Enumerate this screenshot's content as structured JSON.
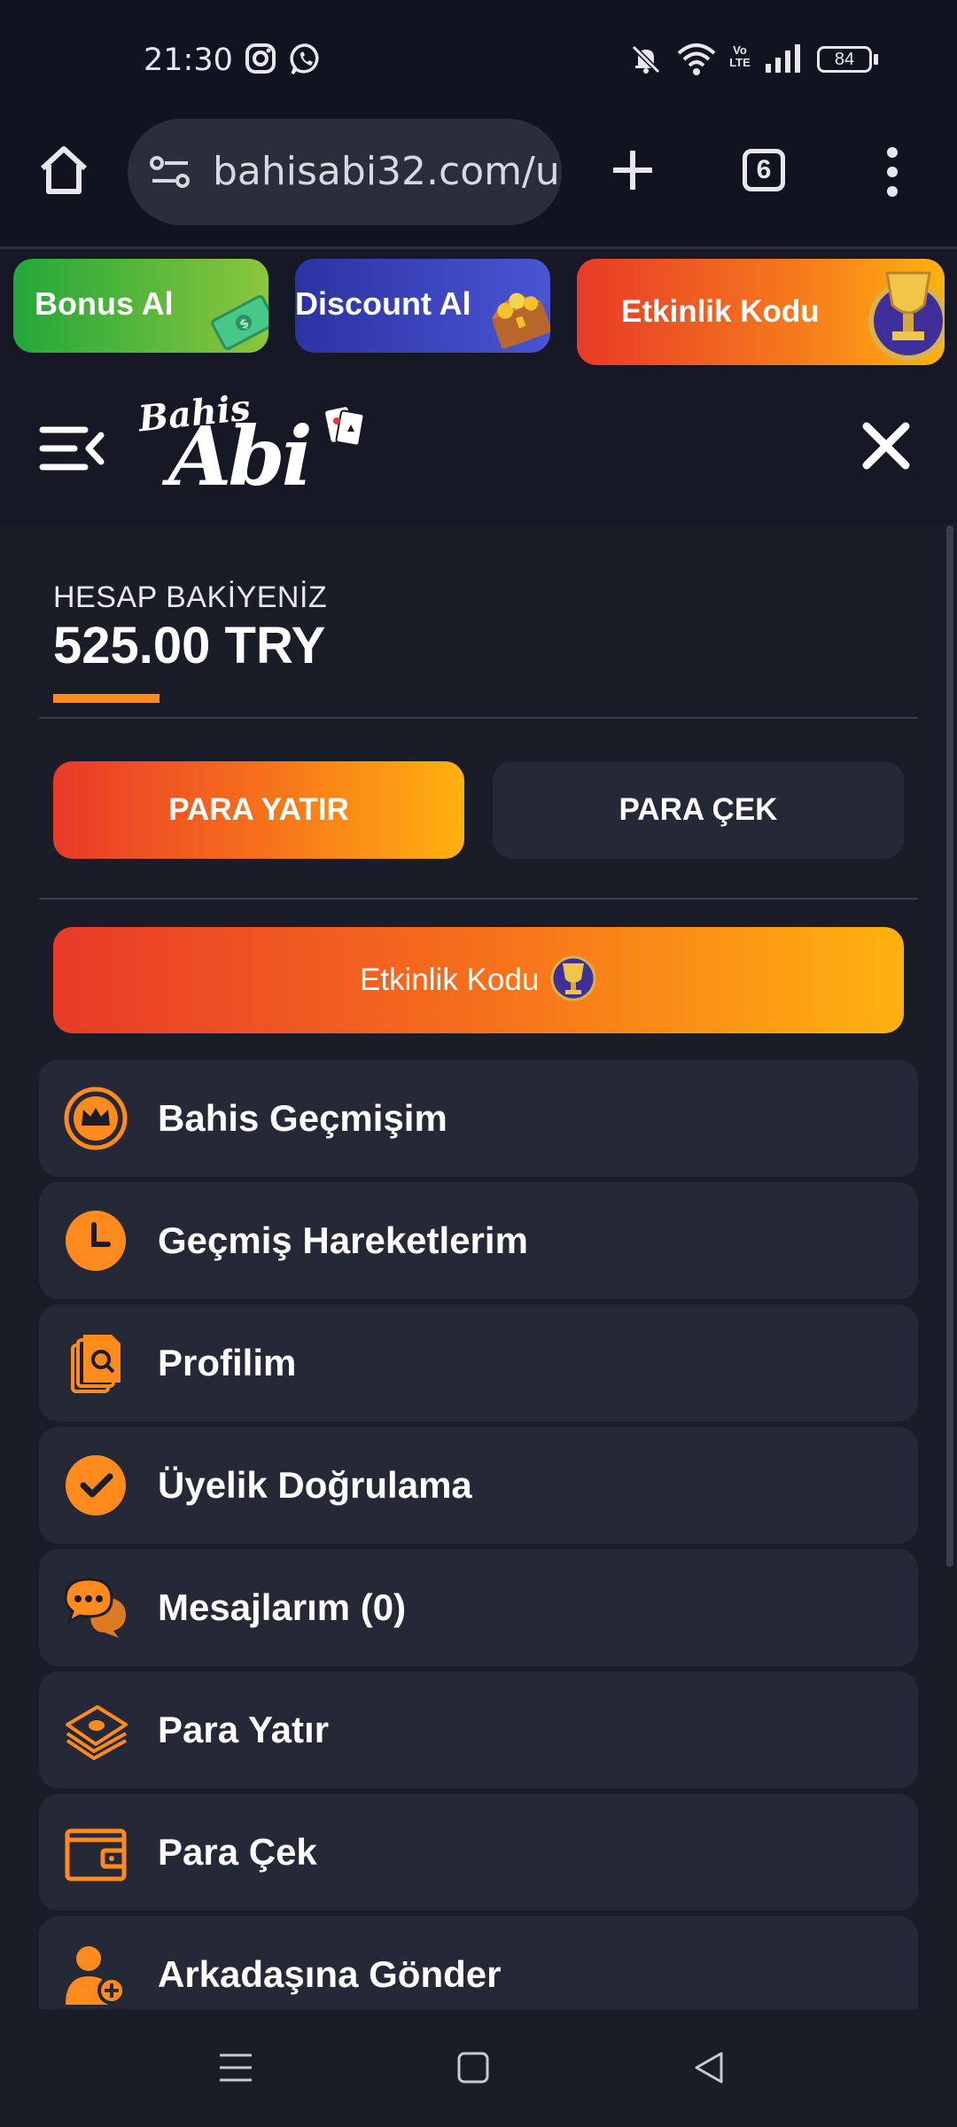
{
  "status_bar": {
    "time": "21:30",
    "battery": "84",
    "network_label": "Vo LTE",
    "icons": [
      "instagram-icon",
      "whatsapp-icon",
      "mute-icon",
      "wifi-icon",
      "volte-icon",
      "signal-icon",
      "battery-icon"
    ]
  },
  "browser": {
    "url": "bahisabi32.com/u",
    "tab_count": "6"
  },
  "promos": [
    {
      "label": "Bonus Al"
    },
    {
      "label": "Discount Al"
    },
    {
      "label": "Etkinlik Kodu"
    }
  ],
  "header": {
    "logo_text_top": "Bahis",
    "logo_text_bottom": "Abi"
  },
  "account": {
    "balance_label": "HESAP BAKİYENİZ",
    "balance_value": "525.00 TRY",
    "deposit_label": "PARA YATIR",
    "withdraw_label": "PARA ÇEK",
    "event_code_label": "Etkinlik Kodu"
  },
  "menu": [
    {
      "label": "Bahis Geçmişim",
      "icon": "crown-icon"
    },
    {
      "label": "Geçmiş Hareketlerim",
      "icon": "clock-icon"
    },
    {
      "label": "Profilim",
      "icon": "document-search-icon"
    },
    {
      "label": "Üyelik Doğrulama",
      "icon": "check-circle-icon"
    },
    {
      "label": "Mesajlarım (0)",
      "icon": "chat-bubbles-icon"
    },
    {
      "label": "Para Yatır",
      "icon": "money-stack-icon"
    },
    {
      "label": "Para Çek",
      "icon": "wallet-icon"
    },
    {
      "label": "Arkadaşına Gönder",
      "icon": "user-add-icon"
    }
  ],
  "colors": {
    "accent_orange": "#ff8a1e",
    "gradient_start": "#e83a28",
    "gradient_end": "#ffb20f",
    "panel_bg": "#1a1c27",
    "item_bg": "#252837"
  }
}
